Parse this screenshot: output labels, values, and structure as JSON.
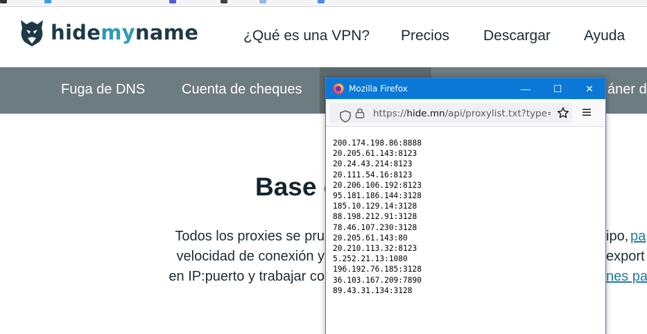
{
  "site": {
    "logo": {
      "part1": "hide",
      "part2": "my",
      "part3": "name"
    },
    "nav": {
      "vpn": "¿Qué es una VPN?",
      "prices": "Precios",
      "download": "Descargar",
      "help": "Ayuda"
    },
    "subnav": {
      "dns_leak": "Fuga de DNS",
      "check_account": "Cuenta de cheques",
      "cut_right": "áner de"
    },
    "hero_title_visible": "Base c",
    "paragraph": {
      "line1_left": "Todos los proxies se pru",
      "line1_right_text": "ipo,",
      "line1_right_link": "pa",
      "line2_left": "velocidad de conexión y",
      "line2_right": "export",
      "line3_left": "en IP:puerto y trabajar co",
      "line3_right_link": "nes pag"
    }
  },
  "firefox": {
    "title": "Mozilla Firefox",
    "url_scheme": "https://",
    "url_host": "hide.mn",
    "url_path": "/api/proxylist.txt?type=s&c",
    "controls": {
      "minimize": "—",
      "maximize": "☐",
      "close": "✕"
    }
  },
  "proxies": [
    "200.174.198.86:8888",
    "20.205.61.143:8123",
    "20.24.43.214:8123",
    "20.111.54.16:8123",
    "20.206.106.192:8123",
    "95.181.186.144:3128",
    "185.10.129.14:3128",
    "88.198.212.91:3128",
    "78.46.107.230:3128",
    "20.205.61.143:80",
    "20.210.113.32:8123",
    "5.252.21.13:1080",
    "196.192.76.185:3128",
    "36.103.167.209:7890",
    "89.43.31.134:3128"
  ],
  "colors": {
    "brand_dark": "#1d3a46",
    "brand_accent": "#2e9bb6",
    "subbar": "#6d7c81",
    "firefox_titlebar": "#0b78d7",
    "link": "#1f7aa3"
  },
  "icons": {
    "logo": "hidemyname-mascot-icon",
    "firefox": "firefox-logo-icon",
    "shield": "tracking-protection-shield-icon",
    "lock": "lock-icon",
    "star": "bookmark-star-icon",
    "menu": "hamburger-menu-icon"
  }
}
